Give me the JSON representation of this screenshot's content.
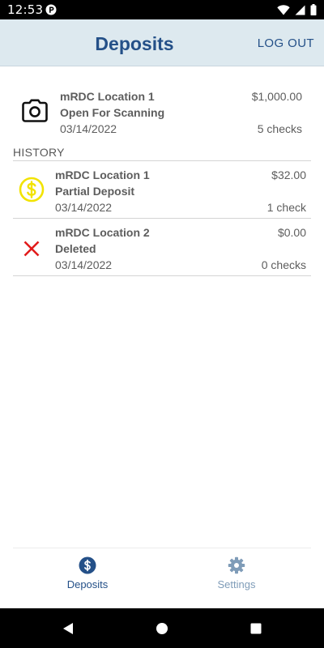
{
  "status_bar": {
    "time": "12:53",
    "icons": [
      "app-notification-icon",
      "wifi-icon",
      "signal-icon",
      "battery-icon"
    ]
  },
  "header": {
    "title": "Deposits",
    "logout_label": "LOG OUT"
  },
  "current_deposit": {
    "icon": "camera-icon",
    "location": "mRDC Location 1",
    "status": "Open For Scanning",
    "date": "03/14/2022",
    "amount": "$1,000.00",
    "check_count": "5 checks"
  },
  "history": {
    "heading": "HISTORY",
    "items": [
      {
        "icon": "dollar-coin-icon",
        "icon_color": "#f2e300",
        "location": "mRDC Location 1",
        "status": "Partial Deposit",
        "date": "03/14/2022",
        "amount": "$32.00",
        "check_count": "1 check"
      },
      {
        "icon": "close-x-icon",
        "icon_color": "#e11b1b",
        "location": "mRDC Location 2",
        "status": "Deleted",
        "date": "03/14/2022",
        "amount": "$0.00",
        "check_count": "0 checks"
      }
    ]
  },
  "bottom_nav": {
    "items": [
      {
        "label": "Deposits",
        "icon": "dollar-circle-icon",
        "active": true
      },
      {
        "label": "Settings",
        "icon": "gear-icon",
        "active": false
      }
    ]
  },
  "colors": {
    "brand": "#245088",
    "header_bg": "#dde9ef",
    "inactive_nav": "#7f9cb8"
  }
}
